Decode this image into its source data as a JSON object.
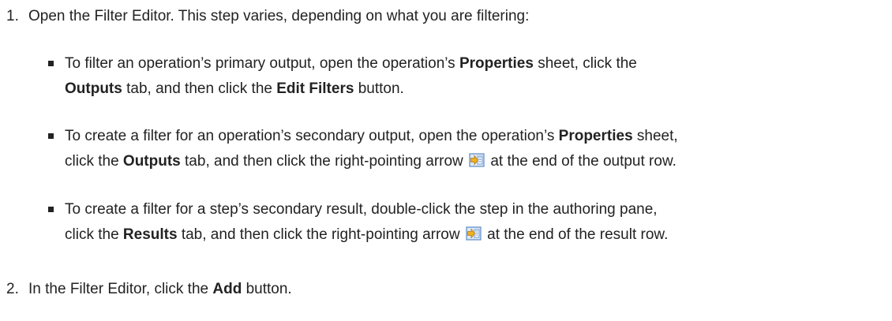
{
  "steps": [
    {
      "number": "1.",
      "text": "Open the Filter Editor. This step varies, depending on what you are filtering:"
    },
    {
      "number": "2.",
      "text_before": "In the Filter Editor, click the ",
      "bold": "Add",
      "text_after": " button."
    }
  ],
  "bullets": [
    {
      "line1": {
        "a": "To filter an operation’s primary output, open the operation’s ",
        "b": "Properties",
        "c": " sheet, click the"
      },
      "line2": {
        "a": "Outputs",
        "b": " tab, and then click the ",
        "c": "Edit Filters",
        "d": " button."
      }
    },
    {
      "line1": {
        "a": "To create a filter for an operation’s secondary output, open the operation’s ",
        "b": "Properties",
        "c": " sheet,"
      },
      "line2": {
        "a": "click the ",
        "b": "Outputs",
        "c": " tab, and then click the right-pointing arrow ",
        "d": " at the end of the output row."
      },
      "icon": "right-pointing-arrow-icon"
    },
    {
      "line1": {
        "a": "To create a filter for a step’s secondary result, double-click the step in the authoring pane,"
      },
      "line2": {
        "a": "click the ",
        "b": "Results",
        "c": " tab, and then click the right-pointing arrow ",
        "d": " at the end of the result row."
      },
      "icon": "right-pointing-arrow-icon"
    }
  ],
  "colors": {
    "text": "#222222",
    "icon_arrow": "#f0b020",
    "icon_box": "#5a8ac8"
  }
}
